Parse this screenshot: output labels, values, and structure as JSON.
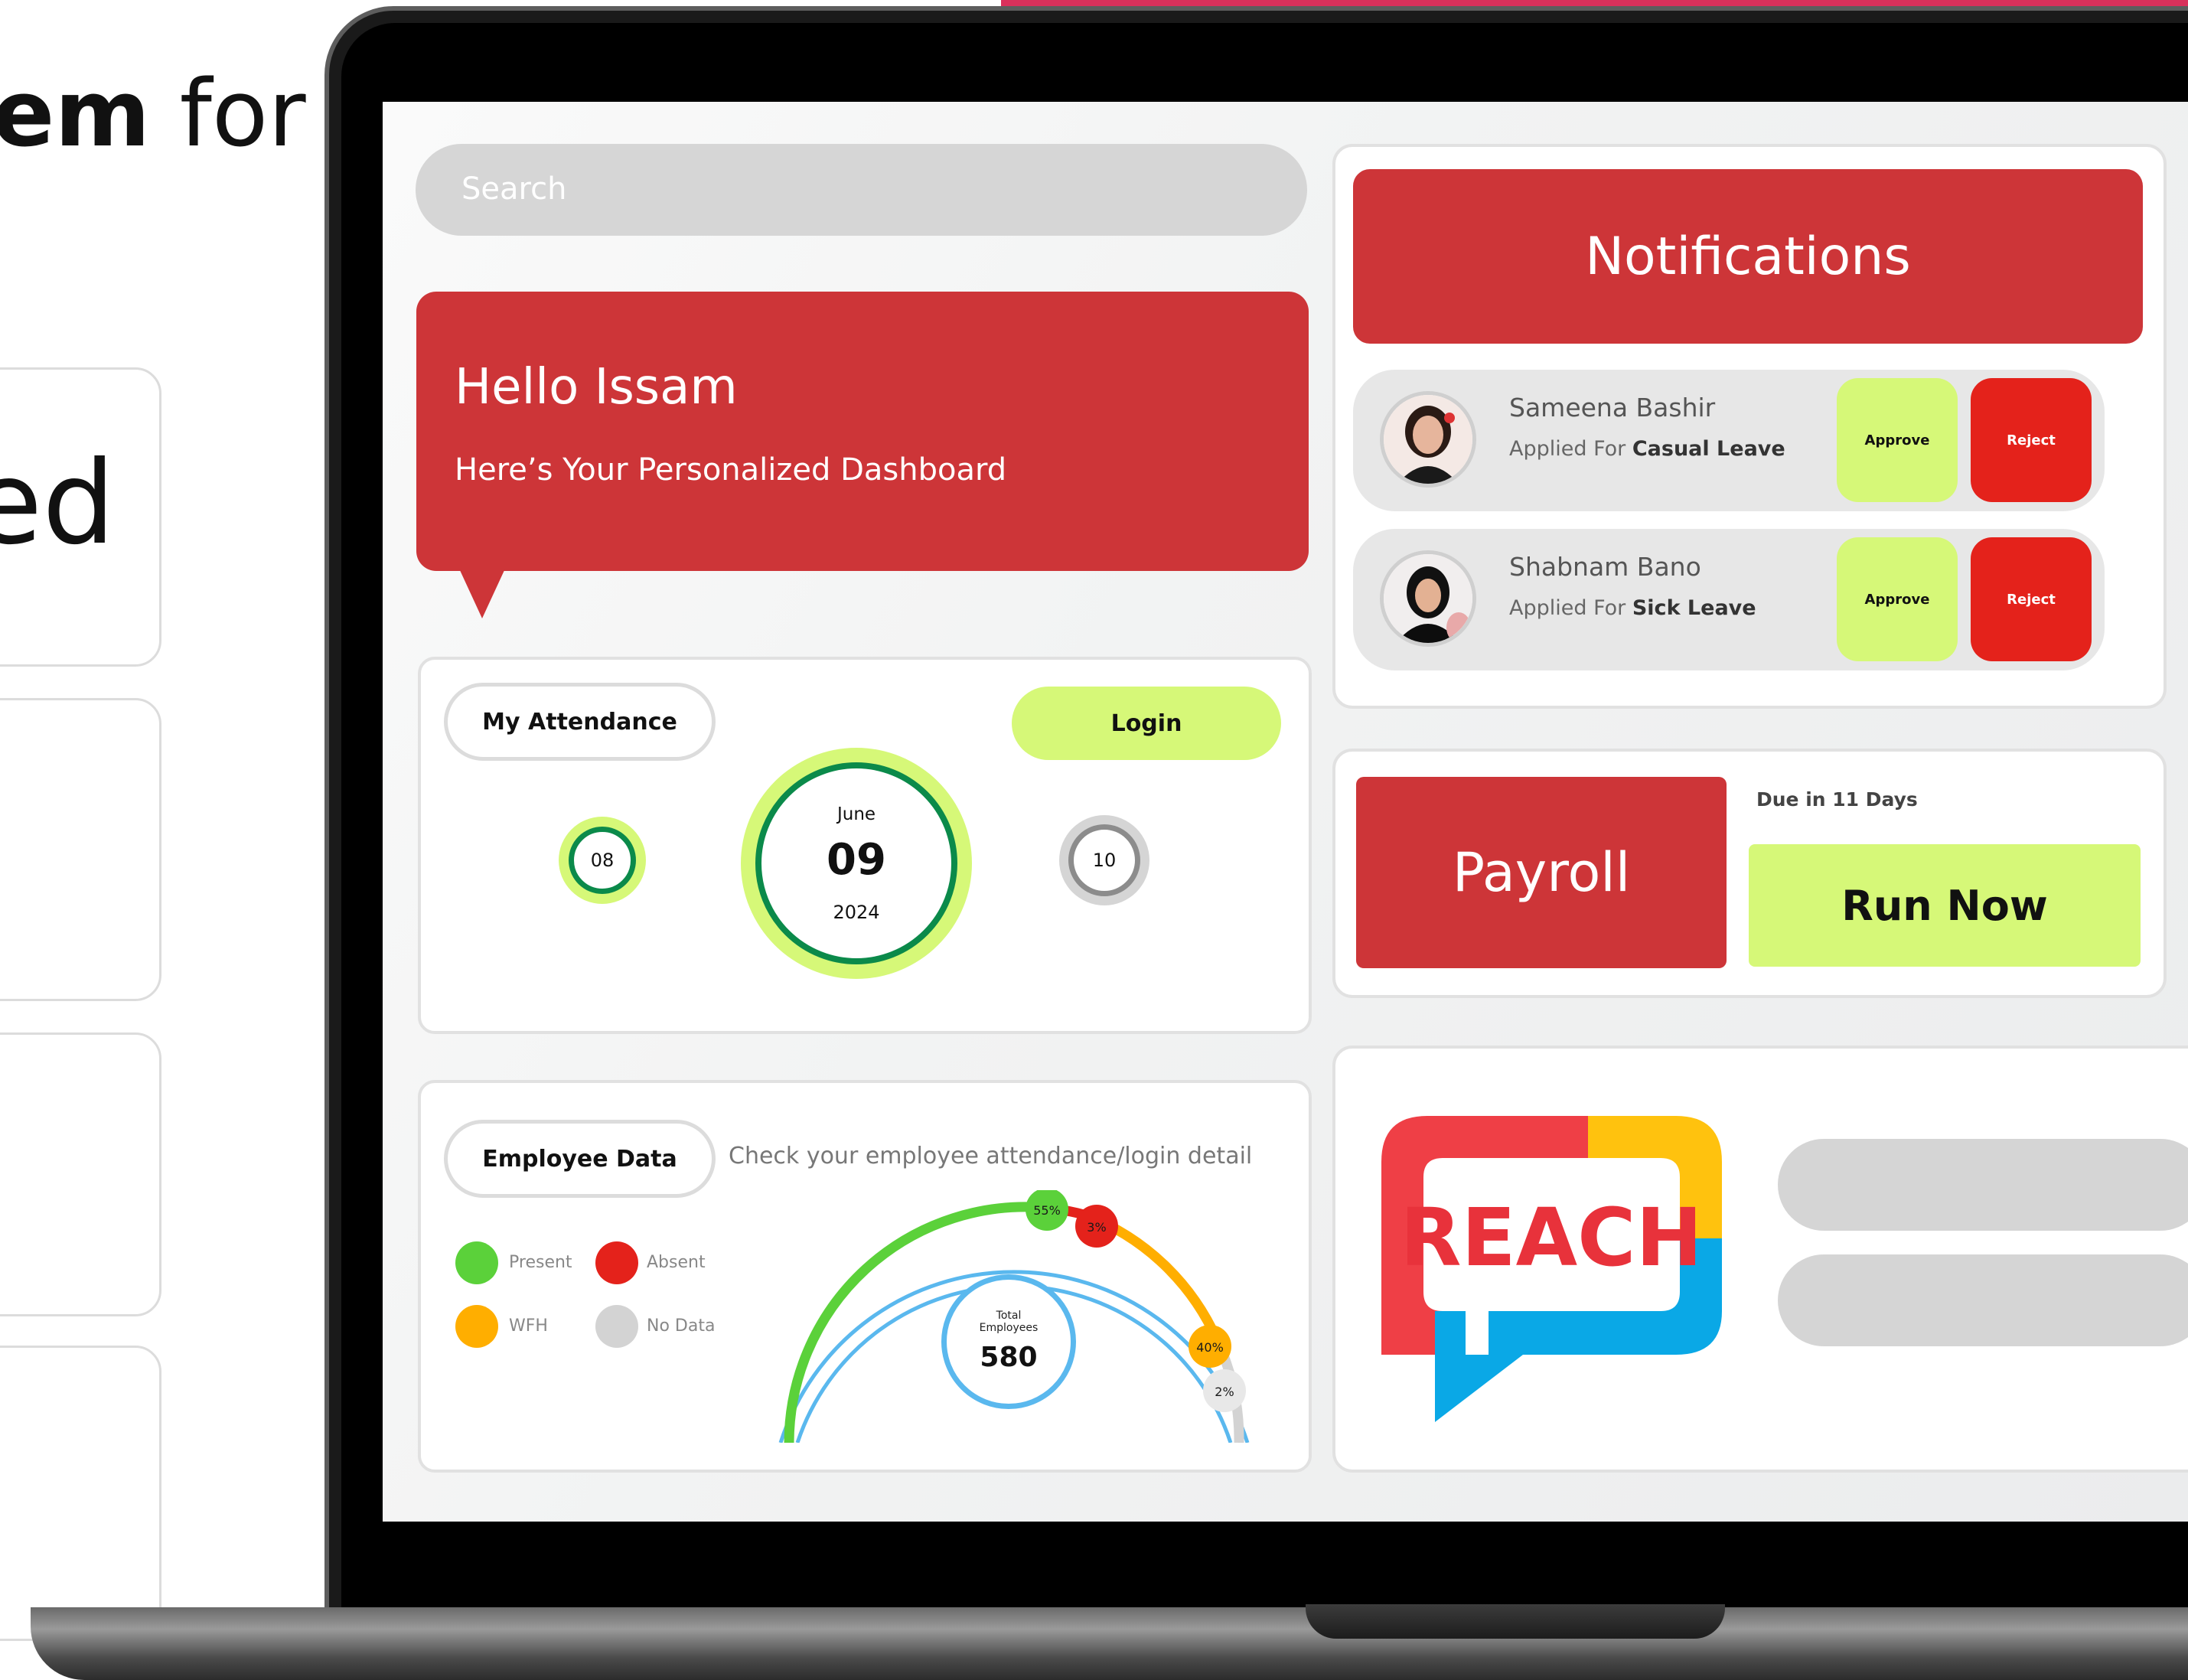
{
  "background_text": {
    "heading_bold": "em",
    "heading_light": " for",
    "card_fragment": "ed"
  },
  "search": {
    "placeholder": "Search"
  },
  "greeting": {
    "title": "Hello Issam",
    "subtitle": "Here’s Your Personalized Dashboard"
  },
  "attendance": {
    "tab_label": "My Attendance",
    "login_label": "Login",
    "prev_day": "08",
    "current_month": "June",
    "current_day": "09",
    "current_year": "2024",
    "next_day": "10"
  },
  "employee_data": {
    "tab_label": "Employee Data",
    "description": "Check your employee attendance/login detail",
    "legend": [
      {
        "label": "Present",
        "color": "#5bd13a"
      },
      {
        "label": "Absent",
        "color": "#e4221b"
      },
      {
        "label": "WFH",
        "color": "#ffae00"
      },
      {
        "label": "No Data",
        "color": "#d3d3d3"
      }
    ],
    "total_label_line1": "Total",
    "total_label_line2": "Employees",
    "total_value": "580",
    "gauge_labels": [
      "55%",
      "3%",
      "40%",
      "2%"
    ]
  },
  "notifications": {
    "title": "Notifications",
    "items": [
      {
        "name": "Sameena Bashir",
        "prefix": "Applied For ",
        "leave_type": "Casual Leave",
        "approve": "Approve",
        "reject": "Reject"
      },
      {
        "name": "Shabnam Bano",
        "prefix": "Applied For ",
        "leave_type": "Sick Leave",
        "approve": "Approve",
        "reject": "Reject"
      }
    ]
  },
  "payroll": {
    "title": "Payroll",
    "due": "Due in 11 Days",
    "action": "Run Now"
  },
  "brand": {
    "logo_text": "REACH",
    "colors": {
      "red": "#ef3f46",
      "yellow": "#ffc20e",
      "blue": "#0aa8e6"
    }
  },
  "colors": {
    "primary_red": "#cd3538",
    "accent_lime": "#d6f878",
    "reject_red": "#e4221b",
    "ring_green": "#0b8a4a"
  }
}
